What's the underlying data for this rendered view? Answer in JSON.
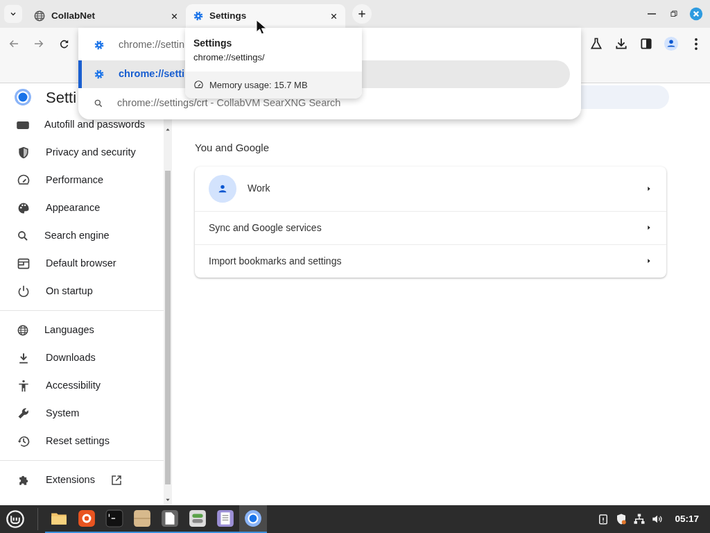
{
  "tabs": [
    {
      "title": "CollabNet",
      "selected": false
    },
    {
      "title": "Settings",
      "selected": true
    }
  ],
  "omnibox_suggestions": [
    {
      "kind": "settings",
      "text": "chrome://settin",
      "selected": false
    },
    {
      "kind": "settings",
      "text": "chrome://setti",
      "selected": true
    },
    {
      "kind": "search",
      "text": "chrome://settings/crt",
      "description": "- CollabVM SearXNG Search",
      "selected": false
    }
  ],
  "hover_card": {
    "title": "Settings",
    "url": "chrome://settings/",
    "memory": "Memory usage: 15.7 MB"
  },
  "settings": {
    "title": "Setti",
    "sidebar": [
      [
        {
          "label": "Autofill and passwords"
        },
        {
          "label": "Privacy and security"
        },
        {
          "label": "Performance"
        },
        {
          "label": "Appearance"
        },
        {
          "label": "Search engine"
        },
        {
          "label": "Default browser"
        },
        {
          "label": "On startup"
        }
      ],
      [
        {
          "label": "Languages"
        },
        {
          "label": "Downloads"
        },
        {
          "label": "Accessibility"
        },
        {
          "label": "System"
        },
        {
          "label": "Reset settings"
        }
      ],
      [
        {
          "label": "Extensions",
          "external": true
        }
      ]
    ],
    "section_title": "You and Google",
    "rows": [
      {
        "kind": "account",
        "label": "Work"
      },
      {
        "kind": "link",
        "label": "Sync and Google services"
      },
      {
        "kind": "link",
        "label": "Import bookmarks and settings"
      }
    ]
  },
  "taskbar": {
    "clock": "05:17"
  }
}
